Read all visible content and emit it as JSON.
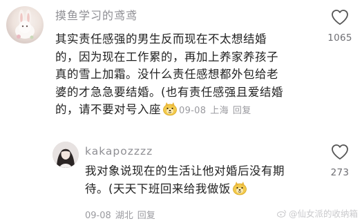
{
  "main_comment": {
    "username": "摸鱼学习的鸢鸢",
    "lines": [
      "其实责任感强的男生反而现在不太想结婚",
      "的，因为现在工作累的，再加上养家养孩子",
      "真的雪上加霜。没什么责任感想都外包给老",
      "婆的才急急要结婚。(也有责任感强且爱结婚",
      "的，请不要对号入座"
    ],
    "emoji": "doge-emoji",
    "date": "09-08",
    "location": "上海",
    "reply_label": "回复",
    "like_count": "1065"
  },
  "reply_comment": {
    "username": "kakapozzzz",
    "lines": [
      "我对象说现在的生活让他对婚后没有期",
      "待。(天天下班回来给我做饭"
    ],
    "emoji": "doge-emoji",
    "date": "09-08",
    "location": "湖北",
    "reply_label": "回复",
    "like_count": "273"
  },
  "watermark": "@仙女派的收纳箱"
}
